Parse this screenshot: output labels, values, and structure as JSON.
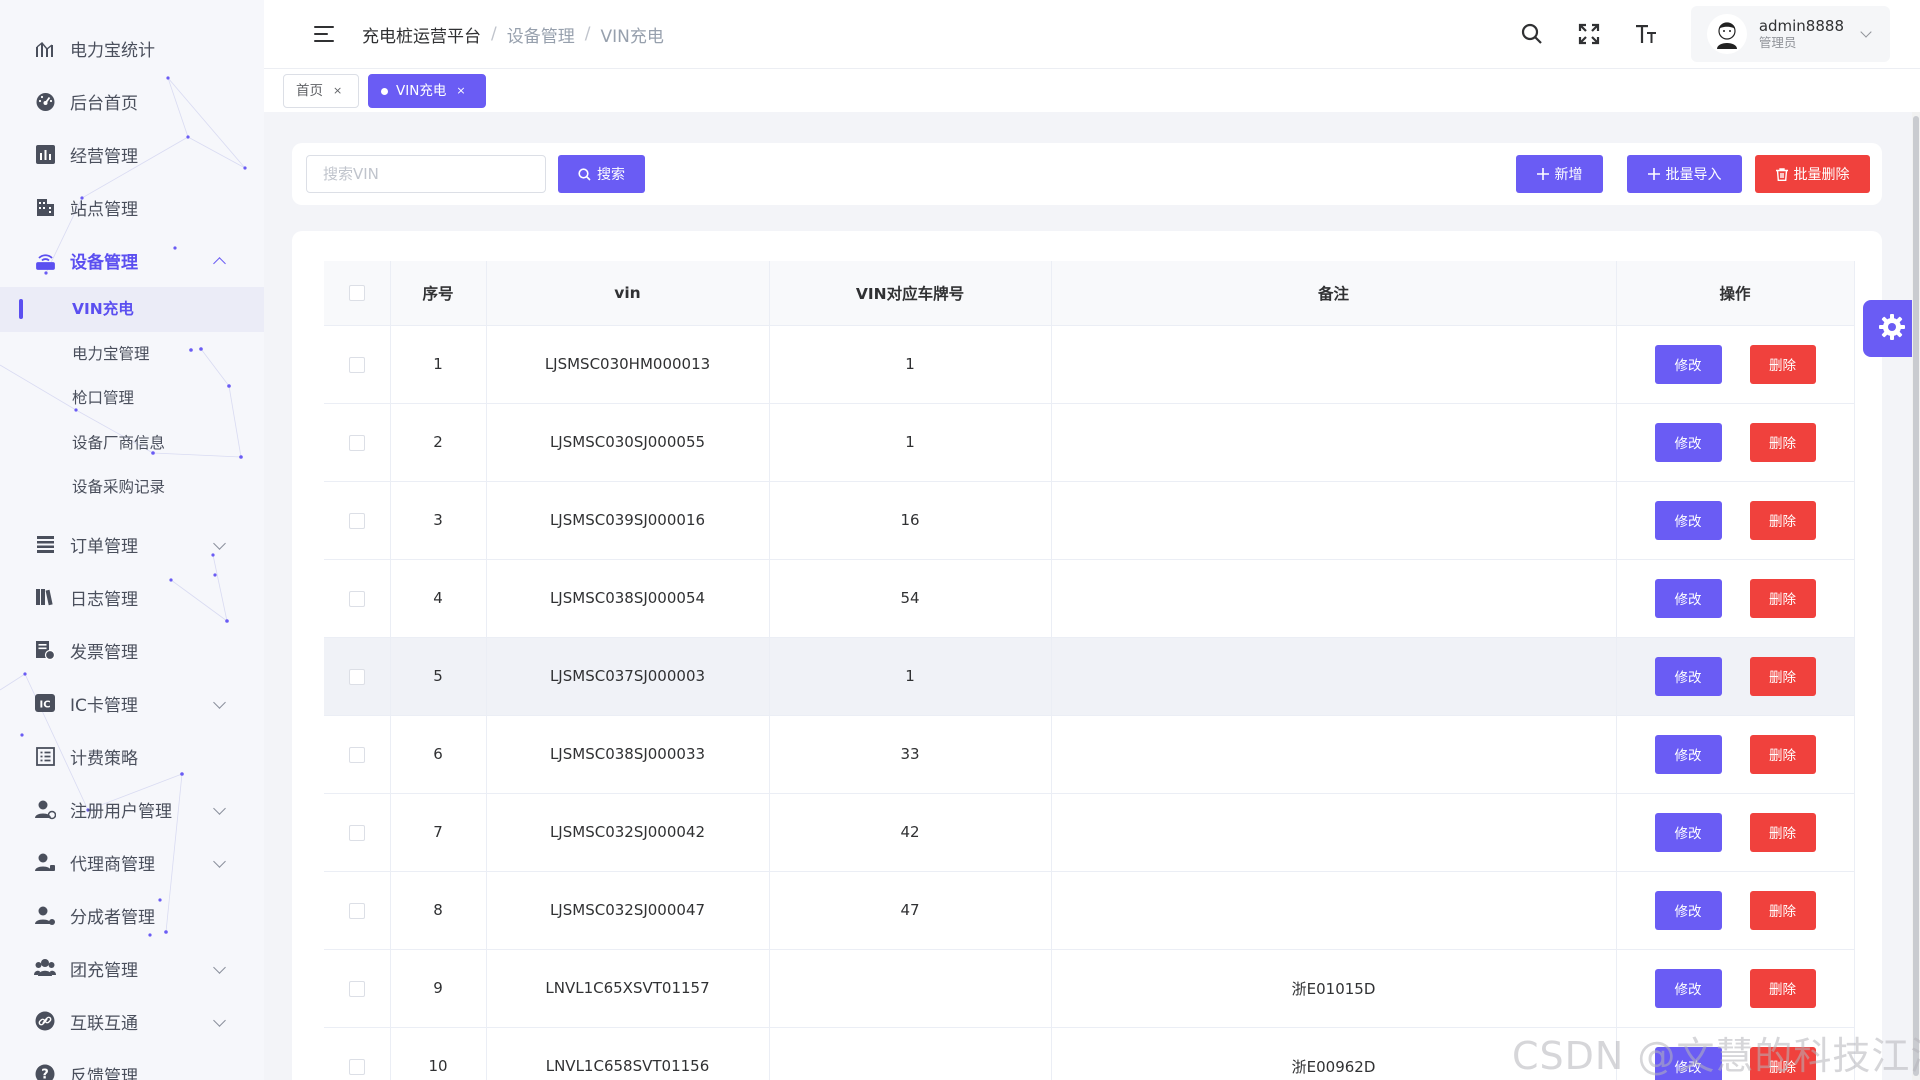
{
  "sidebar": {
    "items": [
      {
        "label": "电力宝统计",
        "icon": "chart-icon"
      },
      {
        "label": "后台首页",
        "icon": "dashboard-icon"
      },
      {
        "label": "经营管理",
        "icon": "bar-chart-icon"
      },
      {
        "label": "站点管理",
        "icon": "building-icon"
      },
      {
        "label": "设备管理",
        "icon": "router-icon",
        "expanded": true
      },
      {
        "label": "订单管理",
        "icon": "list-icon"
      },
      {
        "label": "日志管理",
        "icon": "books-icon"
      },
      {
        "label": "发票管理",
        "icon": "invoice-icon"
      },
      {
        "label": "IC卡管理",
        "icon": "ic-card-icon"
      },
      {
        "label": "计费策略",
        "icon": "billing-icon"
      },
      {
        "label": "注册用户管理",
        "icon": "user-add-icon"
      },
      {
        "label": "代理商管理",
        "icon": "agent-icon"
      },
      {
        "label": "分成者管理",
        "icon": "share-user-icon"
      },
      {
        "label": "团充管理",
        "icon": "group-icon"
      },
      {
        "label": "互联互通",
        "icon": "link-icon"
      },
      {
        "label": "反馈管理",
        "icon": "help-icon"
      }
    ],
    "device_submenu": [
      "VIN充电",
      "电力宝管理",
      "枪口管理",
      "设备厂商信息",
      "设备采购记录"
    ]
  },
  "header": {
    "breadcrumb": [
      "充电桩运营平台",
      "设备管理",
      "VIN充电"
    ],
    "separator": "/",
    "user": {
      "name": "admin8888",
      "role": "管理员"
    }
  },
  "tags": [
    {
      "label": "首页",
      "close": "×"
    },
    {
      "label": "VIN充电",
      "close": "×"
    }
  ],
  "toolbar": {
    "search_placeholder": "搜索VIN",
    "search_label": "搜索",
    "add_label": "新增",
    "import_label": "批量导入",
    "batch_delete_label": "批量删除"
  },
  "table": {
    "columns": [
      "序号",
      "vin",
      "VIN对应车牌号",
      "备注",
      "操作"
    ],
    "edit_label": "修改",
    "delete_label": "删除",
    "rows": [
      {
        "index": "1",
        "vin": "LJSMSC030HM000013",
        "plate": "1",
        "remark": ""
      },
      {
        "index": "2",
        "vin": "LJSMSC030SJ000055",
        "plate": "1",
        "remark": ""
      },
      {
        "index": "3",
        "vin": "LJSMSC039SJ000016",
        "plate": "16",
        "remark": ""
      },
      {
        "index": "4",
        "vin": "LJSMSC038SJ000054",
        "plate": "54",
        "remark": ""
      },
      {
        "index": "5",
        "vin": "LJSMSC037SJ000003",
        "plate": "1",
        "remark": ""
      },
      {
        "index": "6",
        "vin": "LJSMSC038SJ000033",
        "plate": "33",
        "remark": ""
      },
      {
        "index": "7",
        "vin": "LJSMSC032SJ000042",
        "plate": "42",
        "remark": ""
      },
      {
        "index": "8",
        "vin": "LJSMSC032SJ000047",
        "plate": "47",
        "remark": ""
      },
      {
        "index": "9",
        "vin": "LNVL1C65XSVT01157",
        "plate": "",
        "remark": "浙E01015D"
      },
      {
        "index": "10",
        "vin": "LNVL1C658SVT01156",
        "plate": "",
        "remark": "浙E00962D"
      }
    ]
  },
  "watermark": "CSDN @文慧的科技江湖",
  "colors": {
    "primary": "#6a5cf4",
    "danger": "#f0413d",
    "sidebar_bg": "#f6f7fb"
  }
}
